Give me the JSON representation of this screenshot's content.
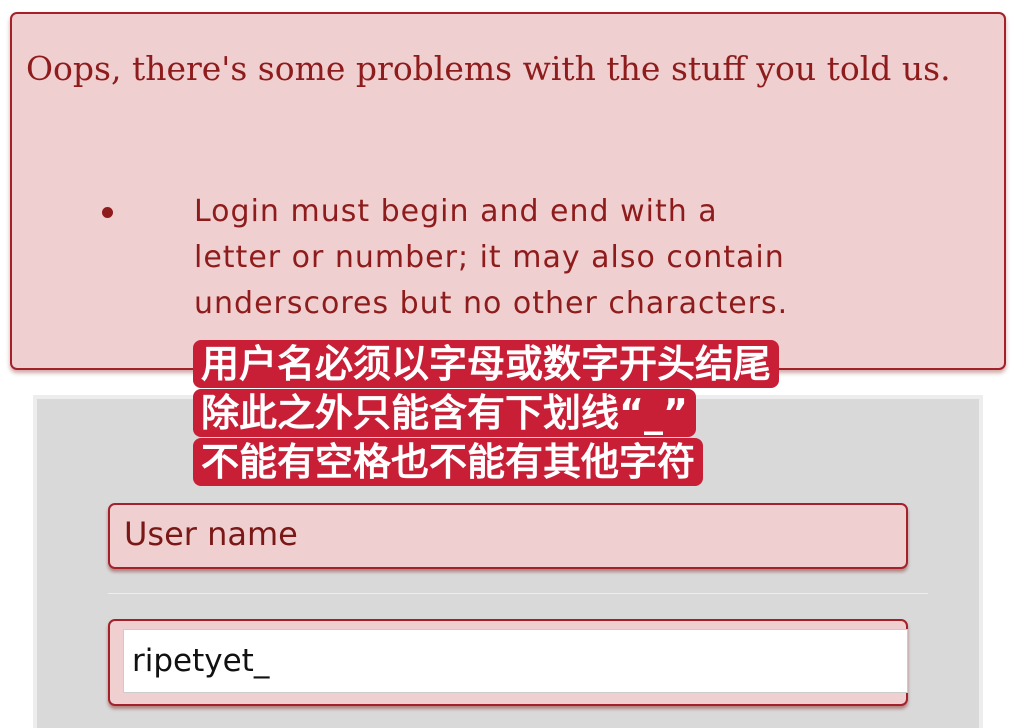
{
  "error": {
    "heading": "Oops, there's some problems with the stuff you told us.",
    "items": [
      "Login must begin and end with a letter or number; it may also contain underscores but no other characters."
    ]
  },
  "form": {
    "username_label": "User name",
    "username_value": "ripetyet_"
  },
  "caption": {
    "lines": [
      "用户名必须以字母或数字开头结尾",
      "除此之外只能含有下划线“_”",
      "不能有空格也不能有其他字符"
    ]
  },
  "colors": {
    "error_bg": "#f0cfd0",
    "error_border": "#a3222a",
    "caption_bg": "#c81f37"
  }
}
